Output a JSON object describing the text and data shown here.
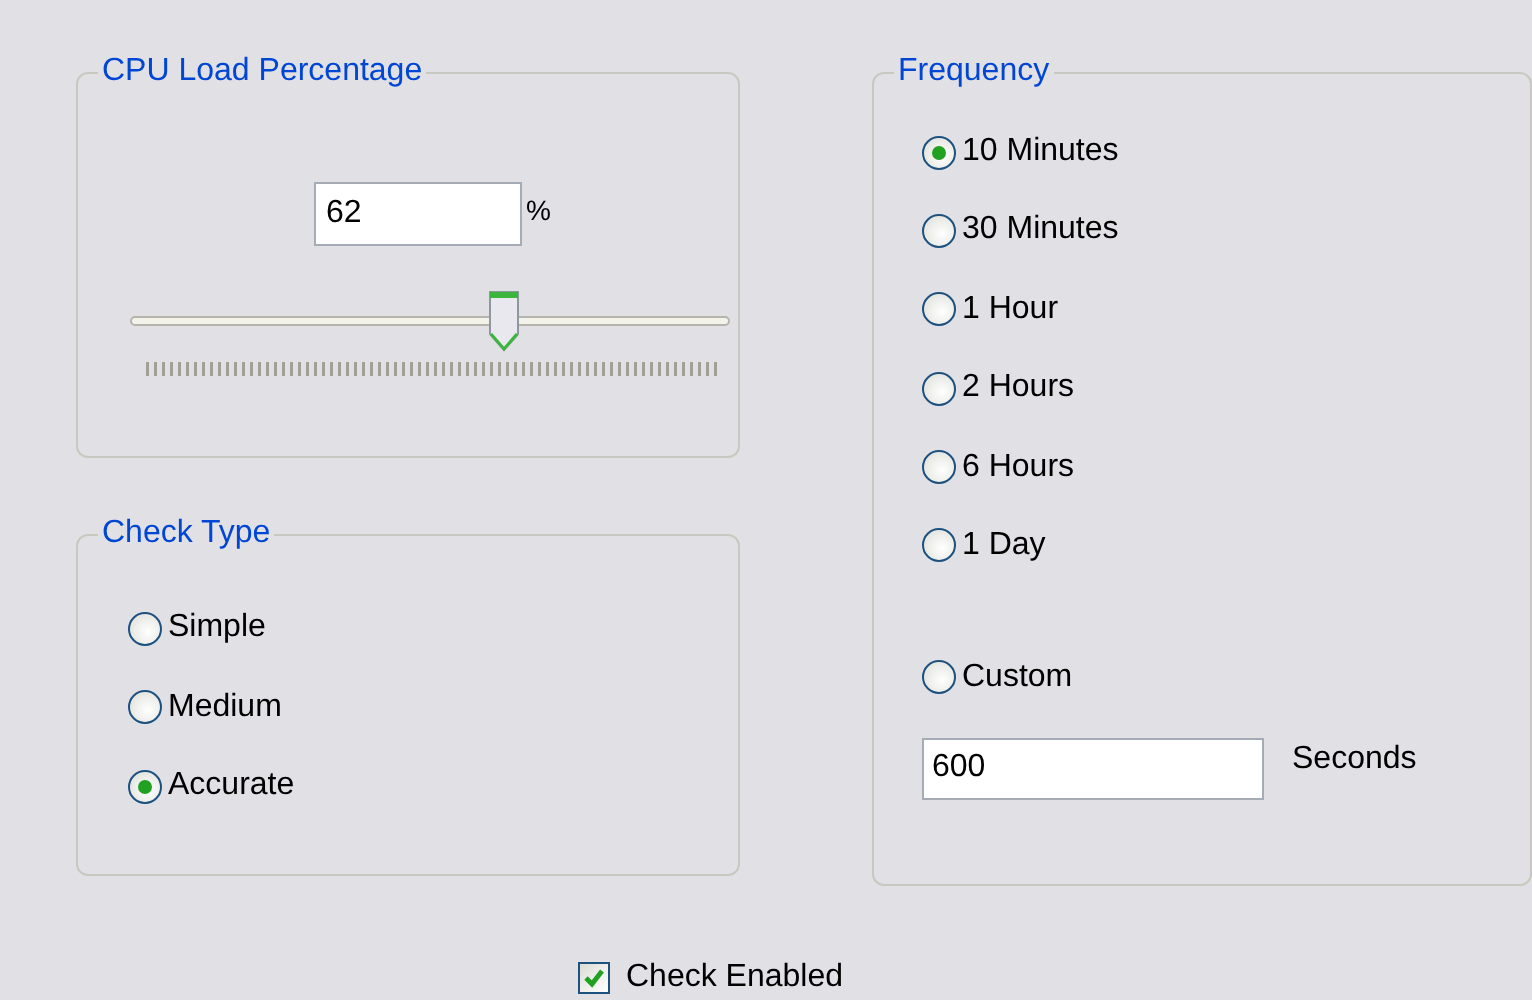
{
  "cpu_load": {
    "title": "CPU Load Percentage",
    "value": "62",
    "unit": "%",
    "level": 0.62
  },
  "check_type": {
    "title": "Check Type",
    "options": [
      {
        "label": "Simple",
        "selected": false
      },
      {
        "label": "Medium",
        "selected": false
      },
      {
        "label": "Accurate",
        "selected": true
      }
    ]
  },
  "frequency": {
    "title": "Frequency",
    "options": [
      {
        "label": "10 Minutes",
        "selected": true
      },
      {
        "label": "30 Minutes",
        "selected": false
      },
      {
        "label": "1 Hour",
        "selected": false
      },
      {
        "label": "2 Hours",
        "selected": false
      },
      {
        "label": "6 Hours",
        "selected": false
      },
      {
        "label": "1 Day",
        "selected": false
      }
    ],
    "custom": {
      "label": "Custom",
      "selected": false
    },
    "seconds": {
      "value": "600",
      "unit": "Seconds"
    }
  },
  "check_enabled": {
    "label": "Check Enabled",
    "checked": true
  }
}
